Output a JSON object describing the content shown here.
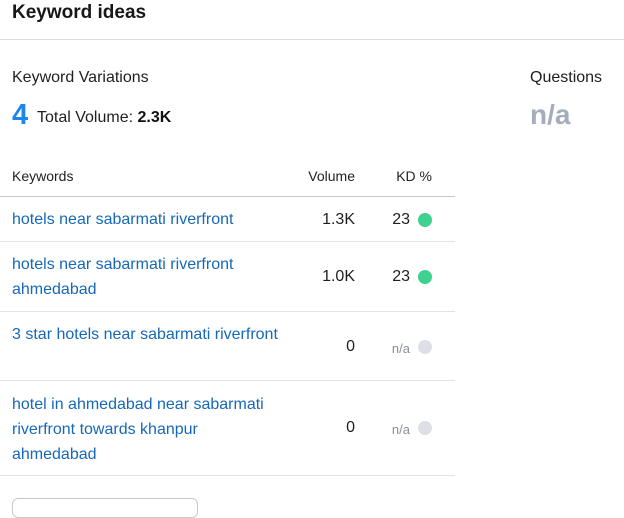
{
  "header": {
    "title": "Keyword ideas"
  },
  "variations": {
    "label": "Keyword Variations",
    "count": "4",
    "total_label": "Total Volume:",
    "total_value": "2.3K"
  },
  "questions": {
    "label": "Questions",
    "value": "n/a"
  },
  "table": {
    "columns": {
      "keyword": "Keywords",
      "volume": "Volume",
      "kd": "KD %"
    },
    "rows": [
      {
        "keyword": "hotels near sabarmati riverfront",
        "volume": "1.3K",
        "kd": "23",
        "kd_color": "#3fd18f"
      },
      {
        "keyword": "hotels near sabarmati riverfront ahmedabad",
        "volume": "1.0K",
        "kd": "23",
        "kd_color": "#3fd18f"
      },
      {
        "keyword": "3 star hotels near sabarmati riverfront",
        "volume": "0",
        "kd": "n/a",
        "kd_color": "#dcdfe6"
      },
      {
        "keyword": "hotel in ahmedabad near sabarmati riverfront towards khanpur ahmedabad",
        "volume": "0",
        "kd": "n/a",
        "kd_color": "#dcdfe6"
      }
    ]
  }
}
